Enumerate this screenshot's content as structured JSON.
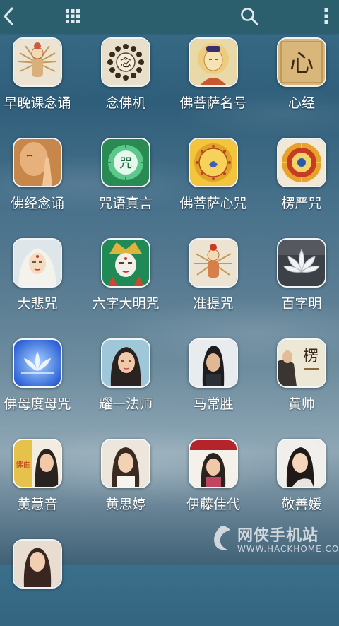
{
  "toolbar": {
    "back_icon": "chevron-left-icon",
    "grid_icon": "grid-icon",
    "search_icon": "search-icon",
    "more_icon": "more-vertical-icon"
  },
  "colors": {
    "toolbar_bg": "#2c5f6e",
    "label_text": "#ffffff",
    "icon_border": "#ffffff"
  },
  "grid": {
    "items": [
      {
        "label": "早晚课念诵",
        "icon": "thousand-arm-bodhisattva-icon"
      },
      {
        "label": "念佛机",
        "icon": "prayer-beads-icon"
      },
      {
        "label": "佛菩萨名号",
        "icon": "buddha-portrait-icon"
      },
      {
        "label": "心经",
        "icon": "calligraphy-heart-icon"
      },
      {
        "label": "佛经念诵",
        "icon": "praying-hands-icon"
      },
      {
        "label": "咒语真言",
        "icon": "mantra-wheel-icon"
      },
      {
        "label": "佛菩萨心咒",
        "icon": "sanskrit-mandala-icon"
      },
      {
        "label": "楞严咒",
        "icon": "mandala-icon"
      },
      {
        "label": "大悲咒",
        "icon": "guanyin-portrait-icon"
      },
      {
        "label": "六字大明咒",
        "icon": "tibetan-deity-icon"
      },
      {
        "label": "准提咒",
        "icon": "cundi-bodhisattva-icon"
      },
      {
        "label": "百字明",
        "icon": "lotus-flower-icon"
      },
      {
        "label": "佛母度母咒",
        "icon": "blue-lotus-icon"
      },
      {
        "label": "耀一法师",
        "icon": "singer-portrait-icon"
      },
      {
        "label": "马常胜",
        "icon": "man-portrait-icon"
      },
      {
        "label": "黄帅",
        "icon": "album-cover-icon"
      },
      {
        "label": "黄慧音",
        "icon": "album-cover-icon"
      },
      {
        "label": "黄思婷",
        "icon": "singer-portrait-icon"
      },
      {
        "label": "伊藤佳代",
        "icon": "album-cover-icon"
      },
      {
        "label": "敬善媛",
        "icon": "singer-portrait-icon"
      },
      {
        "label": "",
        "icon": "singer-portrait-icon"
      }
    ]
  },
  "icon_text": {
    "prayer_beads_char": "念",
    "heart_char": "心",
    "mantra_char": "咒",
    "album_huangshuai_char": "楞",
    "album_huanghuiyin_char": "佛曲"
  },
  "watermark": {
    "title": "网侠手机站",
    "url": "WWW.HACKHOME.COM"
  }
}
